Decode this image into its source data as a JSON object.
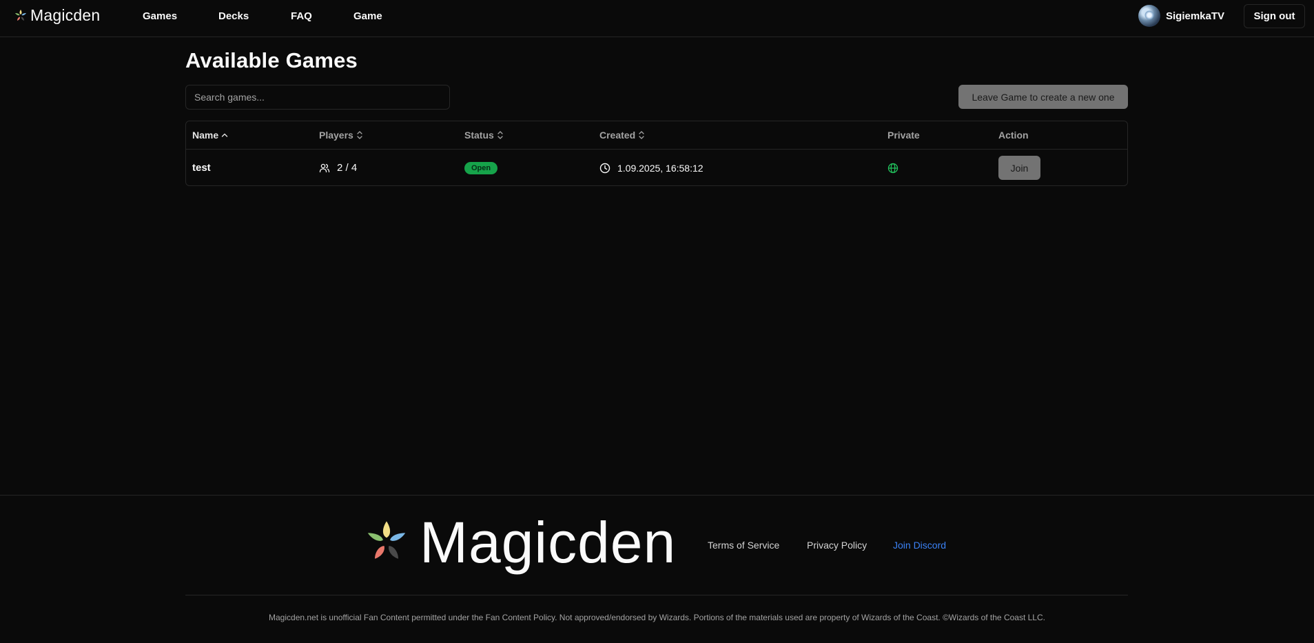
{
  "header": {
    "brand": "Magicden",
    "nav": [
      {
        "label": "Games"
      },
      {
        "label": "Decks"
      },
      {
        "label": "FAQ"
      },
      {
        "label": "Game"
      }
    ],
    "user": {
      "name": "SigiemkaTV",
      "avatar_icon": "user-avatar"
    },
    "signout_label": "Sign out"
  },
  "main": {
    "title": "Available Games",
    "search": {
      "placeholder": "Search games...",
      "value": ""
    },
    "leave_button_label": "Leave Game to create a new one",
    "table": {
      "columns": [
        "Name",
        "Players",
        "Status",
        "Created",
        "Private",
        "Action"
      ],
      "sort": {
        "column": "Name",
        "direction": "asc"
      },
      "rows": [
        {
          "name": "test",
          "players": "2 / 4",
          "status": "Open",
          "created": "1.09.2025, 16:58:12",
          "private_icon": "globe-icon",
          "action_label": "Join"
        }
      ]
    }
  },
  "footer": {
    "brand": "Magicden",
    "links": [
      {
        "label": "Terms of Service"
      },
      {
        "label": "Privacy Policy"
      },
      {
        "label": "Join Discord",
        "color": "#3b82f6"
      }
    ],
    "disclaimer": "Magicden.net is unofficial Fan Content permitted under the Fan Content Policy. Not approved/endorsed by Wizards. Portions of the materials used are property of Wizards of the Coast. ©Wizards of the Coast LLC."
  },
  "colors": {
    "background": "#0a0a0a",
    "border": "#262626",
    "status_open": "#16a34a",
    "link_accent": "#3b82f6",
    "disabled_button": "#737373"
  }
}
